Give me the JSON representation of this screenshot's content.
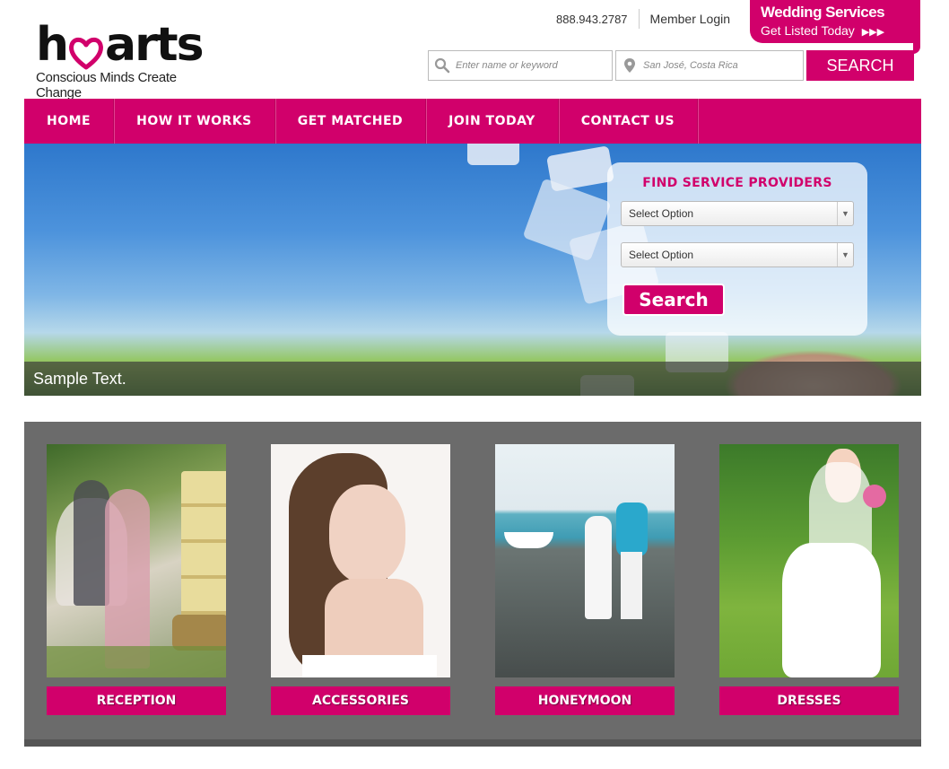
{
  "header": {
    "logo": {
      "word": "hearts",
      "tagline": "Conscious Minds Create Change"
    },
    "phone": "888.943.2787",
    "member_login": "Member Login",
    "wedding_tab": {
      "title": "Wedding Services",
      "subtitle": "Get Listed Today",
      "arrows": "▶▶▶"
    },
    "search": {
      "keyword_placeholder": "Enter name or keyword",
      "location_placeholder": "San José, Costa Rica",
      "button": "SEARCH"
    }
  },
  "nav": {
    "items": [
      {
        "label": "HOME"
      },
      {
        "label": "HOW IT WORKS"
      },
      {
        "label": "GET MATCHED"
      },
      {
        "label": "JOIN TODAY"
      },
      {
        "label": "CONTACT US"
      }
    ]
  },
  "hero": {
    "caption": "Sample Text.",
    "finder": {
      "title": "FIND SERVICE PROVIDERS",
      "select1": "Select Option",
      "select2": "Select Option",
      "button": "Search"
    }
  },
  "categories": [
    {
      "label": "RECEPTION",
      "icon": "reception-photo"
    },
    {
      "label": "ACCESSORIES",
      "icon": "accessories-photo"
    },
    {
      "label": "HONEYMOON",
      "icon": "honeymoon-photo"
    },
    {
      "label": "DRESSES",
      "icon": "dresses-photo"
    }
  ],
  "colors": {
    "brand": "#d1006b",
    "panel": "#6b6b6b"
  }
}
